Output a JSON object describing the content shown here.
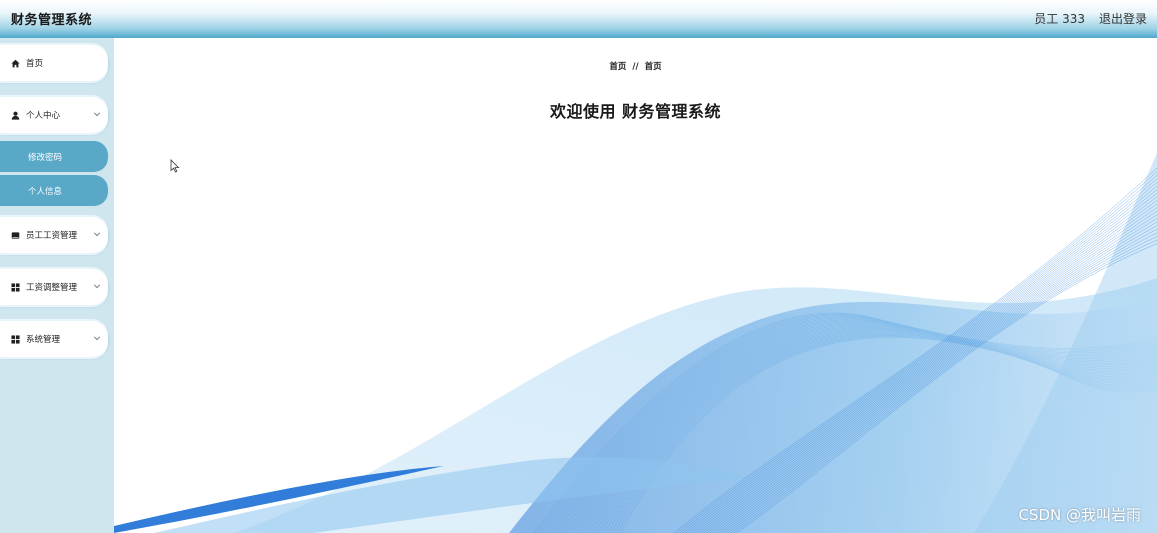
{
  "header": {
    "title": "财务管理系统",
    "user": "员工 333",
    "logout": "退出登录"
  },
  "sidebar": {
    "items": [
      {
        "label": "首页",
        "icon": "home-icon"
      },
      {
        "label": "个人中心",
        "icon": "user-icon",
        "expanded": true,
        "children": [
          {
            "label": "修改密码"
          },
          {
            "label": "个人信息"
          }
        ]
      },
      {
        "label": "员工工资管理",
        "icon": "wallet-icon"
      },
      {
        "label": "工资调整管理",
        "icon": "grid-icon"
      },
      {
        "label": "系统管理",
        "icon": "grid-icon"
      }
    ]
  },
  "main": {
    "breadcrumb": [
      "首页",
      "首页"
    ],
    "breadcrumb_separator": "//",
    "welcome": "欢迎使用 财务管理系统"
  },
  "watermark": "CSDN @我叫岩雨",
  "colors": {
    "header_gradient_end": "#4ea9cc",
    "sidebar_bg": "#cfe6ef",
    "submenu_bg": "#5aa8c8",
    "wave_blue": "#2f7fd6"
  }
}
